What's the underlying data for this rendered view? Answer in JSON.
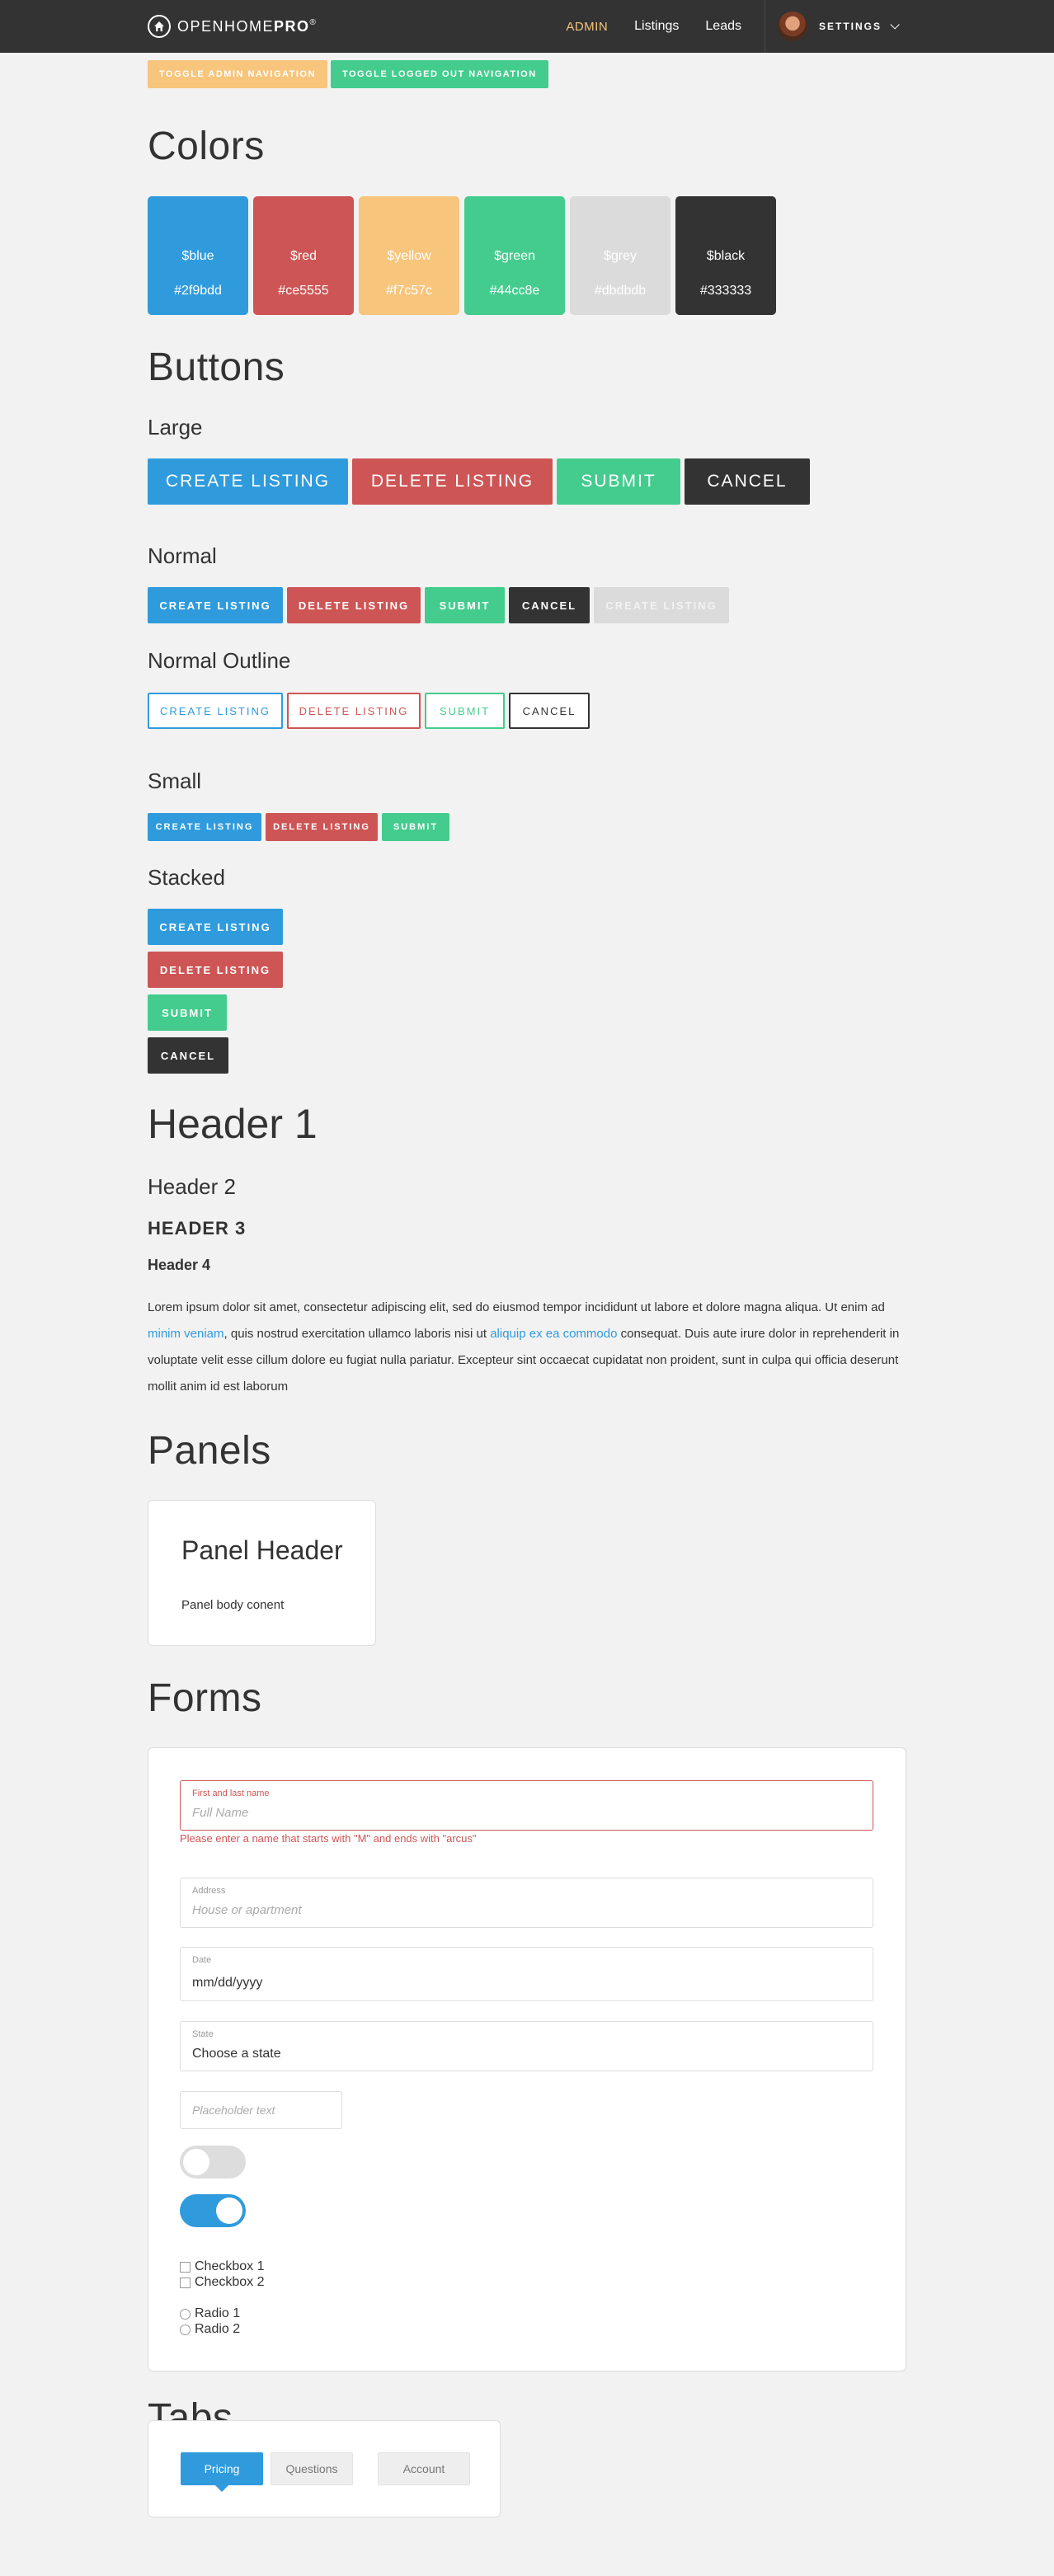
{
  "nav": {
    "brand_light": "OPENHOME",
    "brand_bold": "PRO",
    "brand_reg": "®",
    "links": [
      {
        "label": "ADMIN",
        "active": true
      },
      {
        "label": "Listings",
        "active": false
      },
      {
        "label": "Leads",
        "active": false
      }
    ],
    "settings_label": "SETTINGS"
  },
  "toggles": {
    "admin": "TOGGLE ADMIN NAVIGATION",
    "logged_out": "TOGGLE LOGGED OUT NAVIGATION"
  },
  "colors": {
    "title": "Colors",
    "swatches": [
      {
        "name": "$blue",
        "hex": "#2f9bdd"
      },
      {
        "name": "$red",
        "hex": "#ce5555"
      },
      {
        "name": "$yellow",
        "hex": "#f7c57c"
      },
      {
        "name": "$green",
        "hex": "#44cc8e"
      },
      {
        "name": "$grey",
        "hex": "#dbdbdb"
      },
      {
        "name": "$black",
        "hex": "#333333"
      }
    ]
  },
  "buttons": {
    "title": "Buttons",
    "large": "Large",
    "normal": "Normal",
    "outline": "Normal Outline",
    "small": "Small",
    "stacked": "Stacked",
    "create": "CREATE LISTING",
    "delete": "DELETE LISTING",
    "submit": "SUBMIT",
    "cancel": "CANCEL"
  },
  "typography": {
    "h1": "Header 1",
    "h2": "Header 2",
    "h3": "HEADER 3",
    "h4": "Header 4",
    "p1": "Lorem ipsum dolor sit amet, consectetur adipiscing elit, sed do eiusmod tempor incididunt ut labore et dolore magna aliqua. Ut enim ad ",
    "link1": "minim veniam",
    "p2": ", quis nostrud exercitation ullamco laboris nisi ut ",
    "link2": "aliquip ex ea commodo",
    "p3": " consequat. Duis aute irure dolor in reprehenderit in voluptate velit esse cillum dolore eu fugiat nulla pariatur. Excepteur sint occaecat cupidatat non proident, sunt in culpa qui officia deserunt mollit anim id est laborum"
  },
  "panels": {
    "title": "Panels",
    "header": "Panel Header",
    "body": "Panel body conent"
  },
  "forms": {
    "title": "Forms",
    "name_label": "First and last name",
    "name_placeholder": "Full Name",
    "name_error": "Please enter a name that starts with \"M\" and ends with \"arcus\"",
    "address_label": "Address",
    "address_placeholder": "House or apartment",
    "date_label": "Date",
    "date_value": "mm/dd/yyyy",
    "state_label": "State",
    "state_value": "Choose a state",
    "small_placeholder": "Placeholder text",
    "switch_off": false,
    "switch_on": true,
    "checkbox1": "Checkbox 1",
    "checkbox2": "Checkbox 2",
    "radio1": "Radio 1",
    "radio2": "Radio 2"
  },
  "tabs": {
    "title": "Tabs",
    "items": [
      "Pricing",
      "Questions",
      "Account"
    ],
    "active": "Pricing"
  }
}
